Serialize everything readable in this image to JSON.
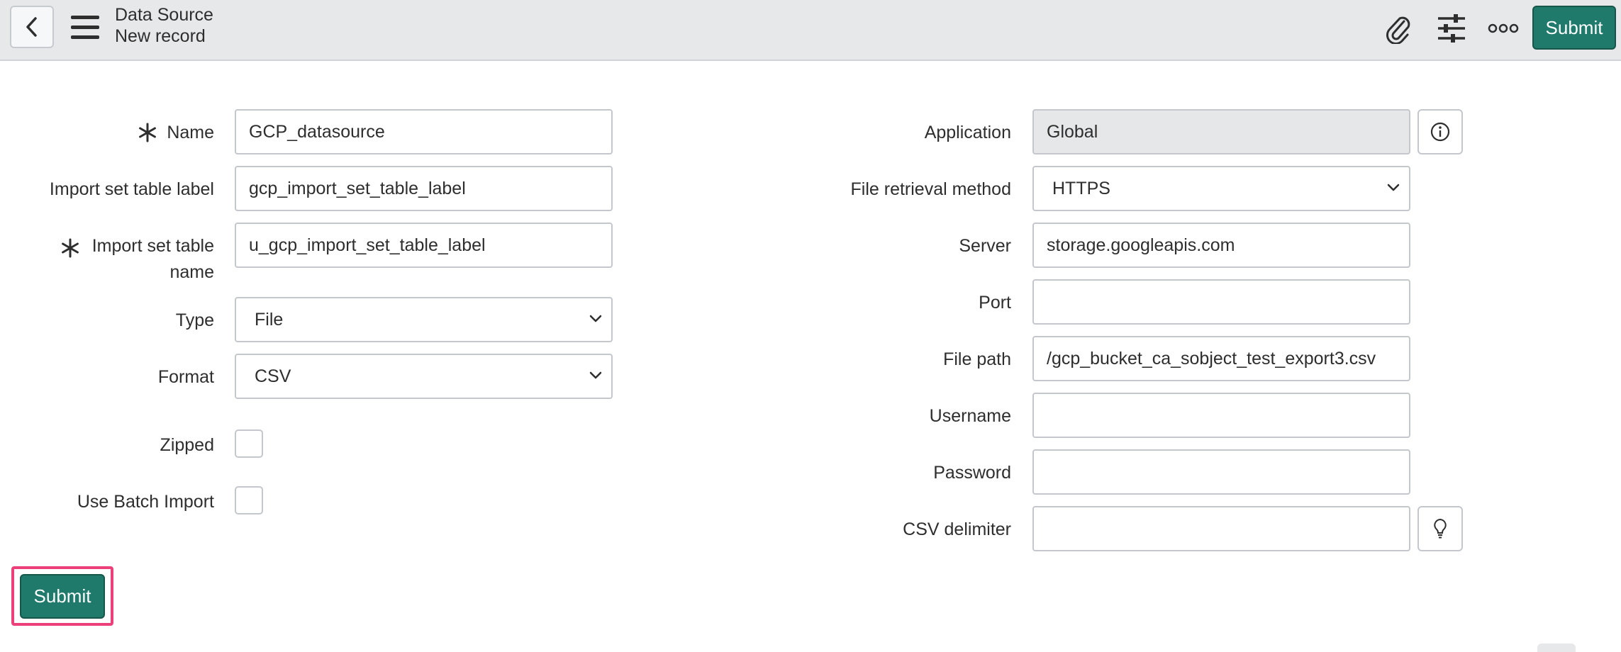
{
  "header": {
    "title": "Data Source",
    "subtitle": "New record",
    "submit_label": "Submit",
    "icons": [
      "back-arrow-icon",
      "hamburger-menu-icon",
      "paperclip-icon",
      "sliders-icon",
      "more-options-icon"
    ]
  },
  "form": {
    "left": {
      "name": {
        "label": "Name",
        "value": "GCP_datasource",
        "required": true
      },
      "import_set_table_label": {
        "label": "Import set table label",
        "value": "gcp_import_set_table_label"
      },
      "import_set_table_name": {
        "label_line1": "Import set table",
        "label_line2": "name",
        "value": "u_gcp_import_set_table_label",
        "required": true
      },
      "type": {
        "label": "Type",
        "value": "File"
      },
      "format": {
        "label": "Format",
        "value": "CSV"
      },
      "zipped": {
        "label": "Zipped",
        "checked": false
      },
      "use_batch_import": {
        "label": "Use Batch Import",
        "checked": false
      }
    },
    "right": {
      "application": {
        "label": "Application",
        "value": "Global"
      },
      "file_retrieval_method": {
        "label": "File retrieval method",
        "value": "HTTPS"
      },
      "server": {
        "label": "Server",
        "value": "storage.googleapis.com"
      },
      "port": {
        "label": "Port",
        "value": ""
      },
      "file_path": {
        "label": "File path",
        "value": "/gcp_bucket_ca_sobject_test_export3.csv"
      },
      "username": {
        "label": "Username",
        "value": ""
      },
      "password": {
        "label": "Password",
        "value": ""
      },
      "csv_delimiter": {
        "label": "CSV delimiter",
        "value": ""
      }
    },
    "submit_label": "Submit"
  },
  "colors": {
    "header_bg": "#e6e8ea",
    "primary_button": "#1f7a6b",
    "highlight_outline": "#ec407a",
    "readonly_bg": "#e6e7e8"
  }
}
